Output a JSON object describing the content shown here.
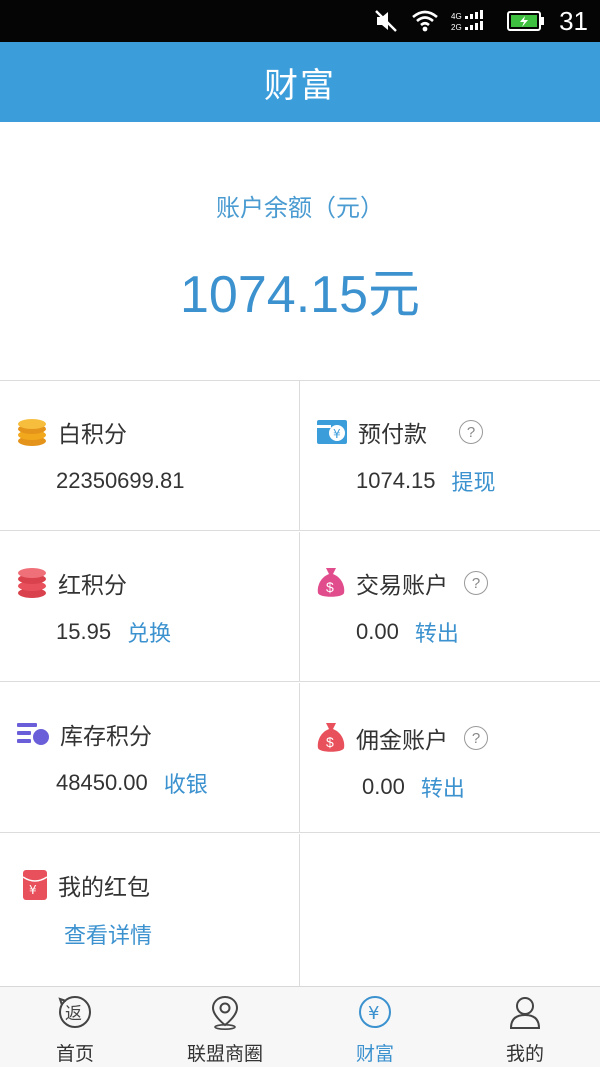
{
  "status_bar": {
    "time": "31",
    "network": "4G 2G"
  },
  "header": {
    "title": "财富"
  },
  "balance": {
    "label": "账户余额（元）",
    "amount": "1074.15元"
  },
  "grid": {
    "items": [
      {
        "name": "白积分",
        "value": "22350699.81",
        "action": "",
        "icon": "coin-stack-icon",
        "help": false
      },
      {
        "name": "预付款",
        "value": "1074.15",
        "action": "提现",
        "icon": "card-yuan-icon",
        "help": true
      },
      {
        "name": "红积分",
        "value": "15.95",
        "action": "兑换",
        "icon": "red-coin-stack-icon",
        "help": false
      },
      {
        "name": "交易账户",
        "value": "0.00",
        "action": "转出",
        "icon": "money-bag-icon",
        "help": true
      },
      {
        "name": "库存积分",
        "value": "48450.00",
        "action": "收银",
        "icon": "inventory-icon",
        "help": false
      },
      {
        "name": "佣金账户",
        "value": "0.00",
        "action": "转出",
        "icon": "money-bag-icon",
        "help": true
      },
      {
        "name": "我的红包",
        "value": "",
        "action": "查看详情",
        "icon": "red-envelope-icon",
        "help": false
      }
    ]
  },
  "help_glyph": "?",
  "tabs": [
    {
      "label": "首页",
      "icon": "return-icon",
      "active": false
    },
    {
      "label": "联盟商圈",
      "icon": "location-pin-icon",
      "active": false
    },
    {
      "label": "财富",
      "icon": "yuan-circle-icon",
      "active": true
    },
    {
      "label": "我的",
      "icon": "user-icon",
      "active": false
    }
  ],
  "colors": {
    "accent": "#3c9ddb",
    "link": "#3c92cf",
    "coin_gold": "#f2a81d",
    "red": "#e8505b",
    "purple": "#6a5fd8",
    "pink": "#e14c8c"
  }
}
